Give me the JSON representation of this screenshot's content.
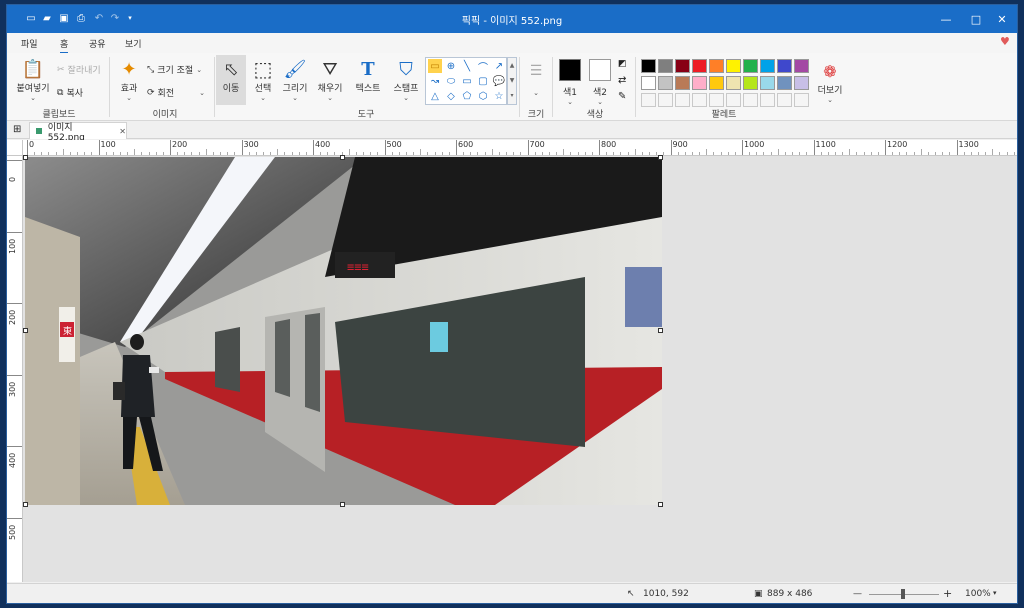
{
  "titlebar": {
    "title": "픽픽 - 이미지 552.png",
    "minimize": "—",
    "maximize": "□",
    "close": "✕"
  },
  "menu": {
    "tabs": [
      "파일",
      "홈",
      "공유",
      "보기"
    ],
    "active": "홈"
  },
  "ribbon": {
    "clipboard": {
      "paste": "붙여넣기",
      "cut": "잘라내기",
      "copy": "복사",
      "label": "클립보드"
    },
    "image": {
      "effects": "효과",
      "resize": "크기 조절",
      "rotate": "회전",
      "label": "이미지"
    },
    "tools": {
      "move": "이동",
      "select": "선택",
      "draw": "그리기",
      "fill": "채우기",
      "text": "텍스트",
      "stamp": "스탬프",
      "label": "도구"
    },
    "size": {
      "label": "크기"
    },
    "colors": {
      "color1": "색1",
      "color2": "색2",
      "label": "색상",
      "color1_value": "#000000",
      "color2_value": "#ffffff"
    },
    "palette": {
      "label": "팔레트",
      "more": "더보기",
      "row1": [
        "#000000",
        "#7f7f7f",
        "#880015",
        "#ed1c24",
        "#ff7f27",
        "#fff200",
        "#22b14c",
        "#00a2e8",
        "#3f48cc",
        "#a349a4"
      ],
      "row2": [
        "#ffffff",
        "#c3c3c3",
        "#b97a57",
        "#ffaec9",
        "#ffc90e",
        "#efe4b0",
        "#b5e61d",
        "#99d9ea",
        "#7092be",
        "#c8bfe7"
      ]
    }
  },
  "document_tab": {
    "name": "이미지 552.png"
  },
  "ruler": {
    "h_ticks": [
      "0",
      "100",
      "200",
      "300",
      "400",
      "500",
      "600",
      "700",
      "800",
      "900",
      "1000",
      "1100",
      "1200",
      "1300"
    ],
    "v_ticks": [
      "0",
      "100",
      "200",
      "300",
      "400",
      "500"
    ]
  },
  "image": {
    "subject": "subway train platform",
    "sign_text": "東"
  },
  "status": {
    "cursor_pos": "1010, 592",
    "image_size": "889 x 486",
    "zoom": "100%",
    "zoom_minus": "—",
    "zoom_plus": "+"
  }
}
